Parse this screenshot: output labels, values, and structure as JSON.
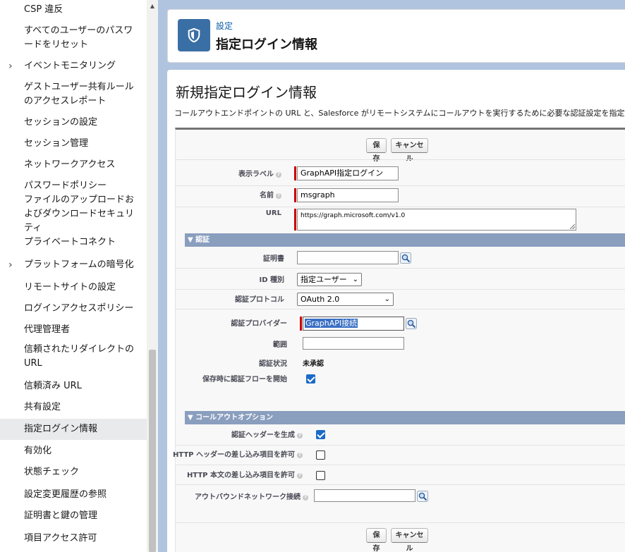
{
  "sidebar": {
    "items": [
      {
        "label": "CSP 違反",
        "expandable": false
      },
      {
        "label": "すべてのユーザーのパスワードをリセット",
        "expandable": false
      },
      {
        "label": "イベントモニタリング",
        "expandable": true
      },
      {
        "label": "ゲストユーザー共有ルールのアクセスレポート",
        "expandable": false
      },
      {
        "label": "セッションの設定",
        "expandable": false
      },
      {
        "label": "セッション管理",
        "expandable": false
      },
      {
        "label": "ネットワークアクセス",
        "expandable": false
      },
      {
        "label": "パスワードポリシー",
        "expandable": false
      },
      {
        "label": "ファイルのアップロードおよびダウンロードセキュリティ",
        "expandable": false
      },
      {
        "label": "プライベートコネクト",
        "expandable": false
      },
      {
        "label": "プラットフォームの暗号化",
        "expandable": true
      },
      {
        "label": "リモートサイトの設定",
        "expandable": false
      },
      {
        "label": "ログインアクセスポリシー",
        "expandable": false
      },
      {
        "label": "代理管理者",
        "expandable": false
      },
      {
        "label": "信頼されたリダイレクトの URL",
        "expandable": false
      },
      {
        "label": "信頼済み URL",
        "expandable": false
      },
      {
        "label": "共有設定",
        "expandable": false
      },
      {
        "label": "指定ログイン情報",
        "expandable": false,
        "active": true
      },
      {
        "label": "有効化",
        "expandable": false
      },
      {
        "label": "状態チェック",
        "expandable": false
      },
      {
        "label": "設定変更履歴の参照",
        "expandable": false
      },
      {
        "label": "証明書と鍵の管理",
        "expandable": false
      },
      {
        "label": "項目アクセス許可",
        "expandable": false
      }
    ]
  },
  "header": {
    "icon": "shield-icon",
    "eyebrow": "設定",
    "title": "指定ログイン情報"
  },
  "page": {
    "title": "新規指定ログイン情報",
    "description": "コールアウトエンドポイントの URL と、Salesforce がリモートシステムにコールアウトを実行するために必要な認証設定を指定します。"
  },
  "buttons": {
    "save": "保存",
    "cancel": "キャンセル"
  },
  "form": {
    "label_label": "表示ラベル",
    "label_value": "GraphAPI指定ログイン",
    "name_label": "名前",
    "name_value": "msgraph",
    "url_label": "URL",
    "url_value": "https://graph.microsoft.com/v1.0",
    "auth_section": "▼ 認証",
    "cert_label": "証明書",
    "cert_value": "",
    "idtype_label": "ID 種別",
    "idtype_value": "指定ユーザー",
    "protocol_label": "認証プロトコル",
    "protocol_value": "OAuth 2.0",
    "provider_label": "認証プロバイダー",
    "provider_value": "GraphAPI接続",
    "scope_label": "範囲",
    "scope_value": "",
    "status_label": "認証状況",
    "status_value": "未承認",
    "startflow_label": "保存時に認証フローを開始",
    "startflow_checked": true,
    "callout_section": "▼ コールアウトオプション",
    "genheader_label": "認証ヘッダーを生成",
    "genheader_checked": true,
    "httpheader_label": "HTTP ヘッダーの差し込み項目を許可",
    "httpheader_checked": false,
    "httpbody_label": "HTTP 本文の差し込み項目を許可",
    "httpbody_checked": false,
    "outbound_label": "アウトバウンドネットワーク接続",
    "outbound_value": ""
  },
  "colors": {
    "accent": "#0b5cab",
    "section_bar": "#8a9ebe",
    "required": "#cc0000",
    "checkbox": "#1b6ac9"
  }
}
